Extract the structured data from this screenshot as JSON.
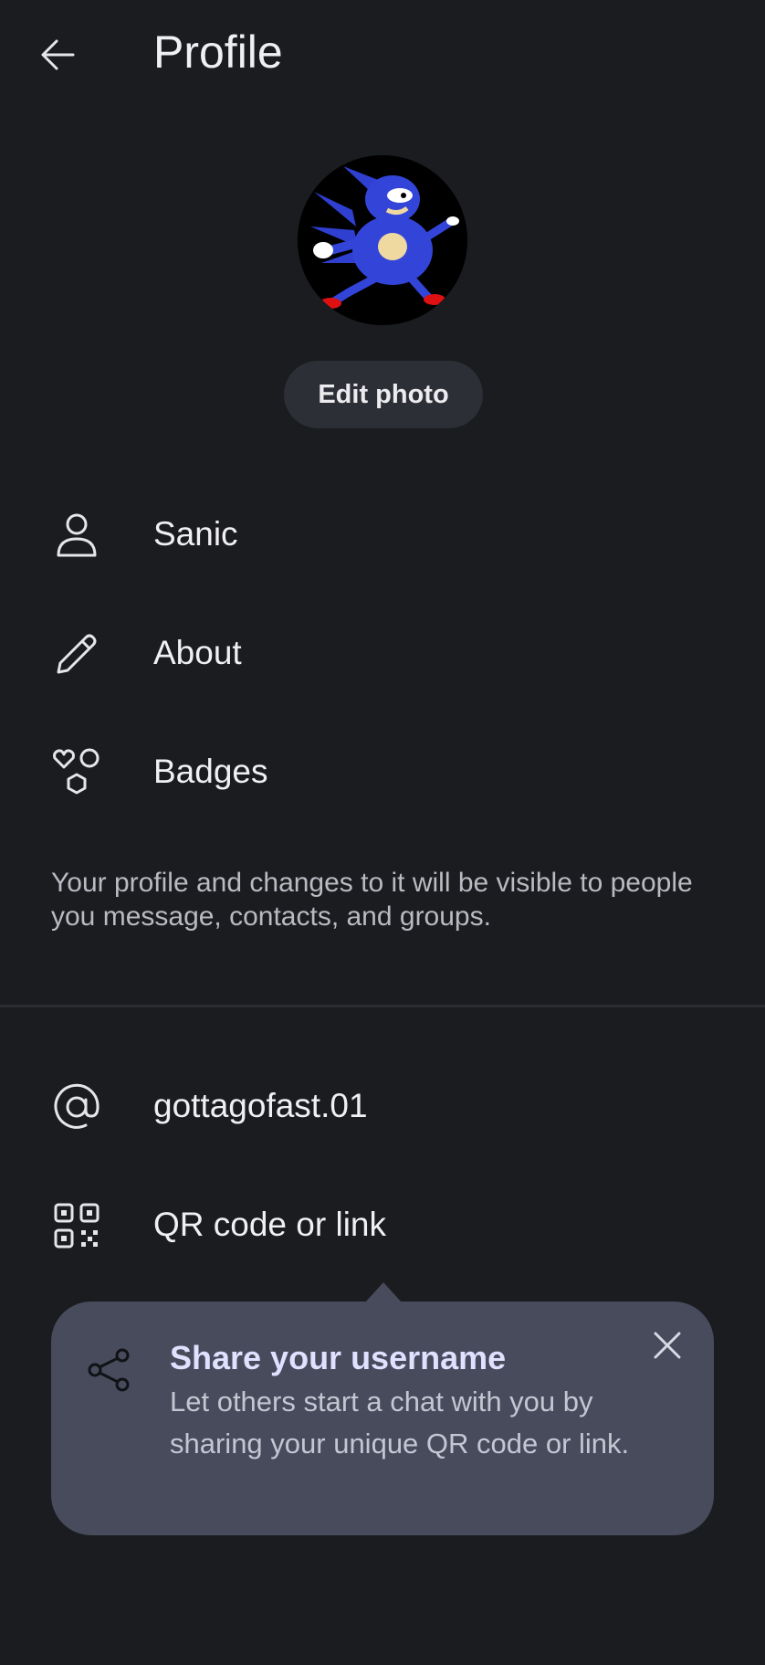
{
  "header": {
    "title": "Profile",
    "back_icon": "arrow-left-icon"
  },
  "profile": {
    "avatar_alt": "Sonic-style character avatar",
    "edit_photo_label": "Edit photo"
  },
  "rows": [
    {
      "icon": "person-icon",
      "label": "Sanic"
    },
    {
      "icon": "pencil-icon",
      "label": "About"
    },
    {
      "icon": "badges-icon",
      "label": "Badges"
    }
  ],
  "note": "Your profile and changes to it will be visible to people you message, contacts, and groups.",
  "account_rows": [
    {
      "icon": "at-sign-icon",
      "label": "gottagofast.01"
    },
    {
      "icon": "qr-code-icon",
      "label": "QR code or link"
    }
  ],
  "tooltip": {
    "icon": "share-icon",
    "title": "Share your username",
    "body": "Let others start a chat with you by sharing your unique QR code or link.",
    "close_icon": "close-icon"
  },
  "colors": {
    "background": "#1b1c1f",
    "button_bg": "#2d2f36",
    "tooltip_bg": "#474b5c",
    "tooltip_title": "#dfe1ff"
  }
}
